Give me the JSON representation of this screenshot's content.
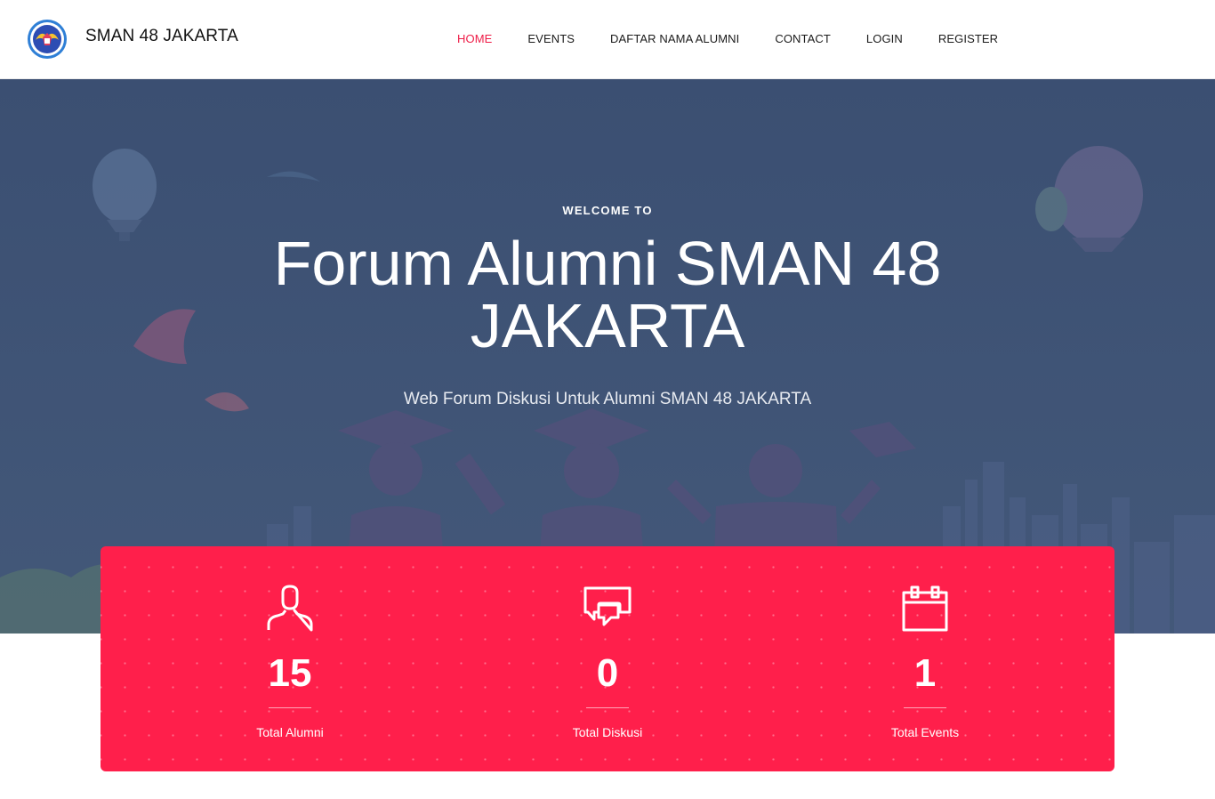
{
  "brand": {
    "name": "SMAN 48 JAKARTA"
  },
  "nav": {
    "items": [
      {
        "label": "HOME",
        "active": true
      },
      {
        "label": "EVENTS",
        "active": false
      },
      {
        "label": "DAFTAR NAMA ALUMNI",
        "active": false
      },
      {
        "label": "CONTACT",
        "active": false
      },
      {
        "label": "LOGIN",
        "active": false
      },
      {
        "label": "REGISTER",
        "active": false
      }
    ]
  },
  "hero": {
    "kicker": "WELCOME TO",
    "title": "Forum Alumni SMAN 48 JAKARTA",
    "subtitle": "Web Forum Diskusi Untuk Alumni SMAN 48 JAKARTA"
  },
  "stats": [
    {
      "icon": "user-icon",
      "value": "15",
      "label": "Total Alumni"
    },
    {
      "icon": "chat-icon",
      "value": "0",
      "label": "Total Diskusi"
    },
    {
      "icon": "calendar-icon",
      "value": "1",
      "label": "Total Events"
    }
  ],
  "colors": {
    "accent": "#ff1f4b",
    "nav_active": "#ee1c47",
    "hero_bg": "#3d5173"
  }
}
